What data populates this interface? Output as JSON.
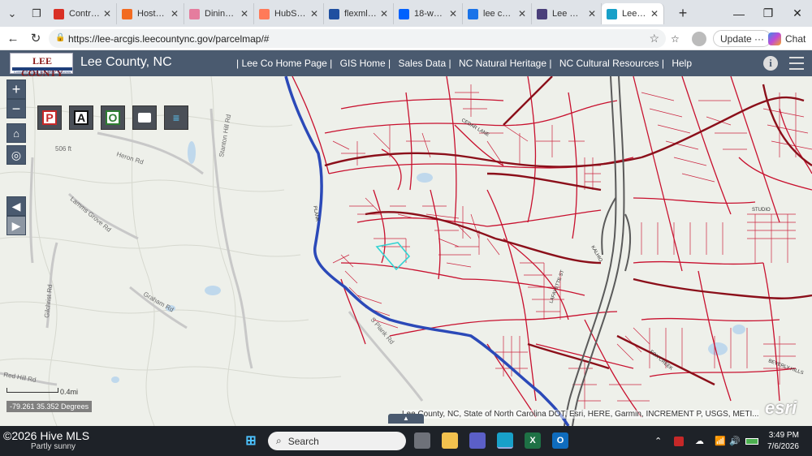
{
  "browser": {
    "tabs": [
      {
        "title": "Contracts",
        "icon": "gmail-icon",
        "color": "#d93025"
      },
      {
        "title": "Hostaway",
        "icon": "hostaway-icon",
        "color": "#f26b21"
      },
      {
        "title": "Dining an",
        "icon": "dining-icon",
        "color": "#e57d9e"
      },
      {
        "title": "HubSpot",
        "icon": "hubspot-icon",
        "color": "#ff7a59"
      },
      {
        "title": "flexmls W",
        "icon": "flexmls-icon",
        "color": "#1f4fa0"
      },
      {
        "title": "18-web-o",
        "icon": "dropbox-icon",
        "color": "#0061fe"
      },
      {
        "title": "lee count",
        "icon": "search-icon",
        "color": "#1a73e8"
      },
      {
        "title": "Lee Coun",
        "icon": "globe-icon",
        "color": "#4a3f7a"
      },
      {
        "title": "Lee Coun",
        "icon": "edge-icon",
        "color": "#18a0c8",
        "active": true
      }
    ],
    "url": "https://lee-arcgis.leecountync.gov/parcelmap/#",
    "update_label": "Update",
    "chat_label": "Chat"
  },
  "app": {
    "logo_top": "LEE COUNTY",
    "logo_bottom": "Connected Today for a Better Tomorrow",
    "title": "Lee County, NC",
    "nav": [
      "| Lee Co Home Page |",
      "GIS Home |",
      "Sales Data |",
      "NC Natural Heritage |",
      "NC Cultural Resources |",
      "Help"
    ]
  },
  "map": {
    "tools": [
      {
        "label": "P",
        "color": "#c62828"
      },
      {
        "label": "A",
        "color": "#111111"
      },
      {
        "label": "O",
        "color": "#2e7d32"
      }
    ],
    "labels": [
      "506 ft",
      "Heron Rd",
      "Stanton Hill Rd",
      "Lamms Grove Rd",
      "Graham Rd",
      "Gilchrist Rd",
      "S Plank Rd",
      "Red Hill Rd",
      "PLANK",
      "CEDAR LANE",
      "STUDIO",
      "BEVERLY HILLS",
      "KALHIO",
      "LAFAYETTE ST",
      "FOX CREEK"
    ],
    "scale_label": "0.4mi",
    "coordinates": "-79.261 35.352 Degrees",
    "attribution": "Lee County, NC, State of North Carolina DOT, Esri, HERE, Garmin, INCREMENT P, USGS, METI...",
    "esri_logo": "esri"
  },
  "taskbar": {
    "weather_top": "©2026 Hive MLS",
    "weather_bottom": "Partly sunny",
    "search_label": "Search",
    "time": "3:49 PM",
    "date": "7/6/2026"
  }
}
